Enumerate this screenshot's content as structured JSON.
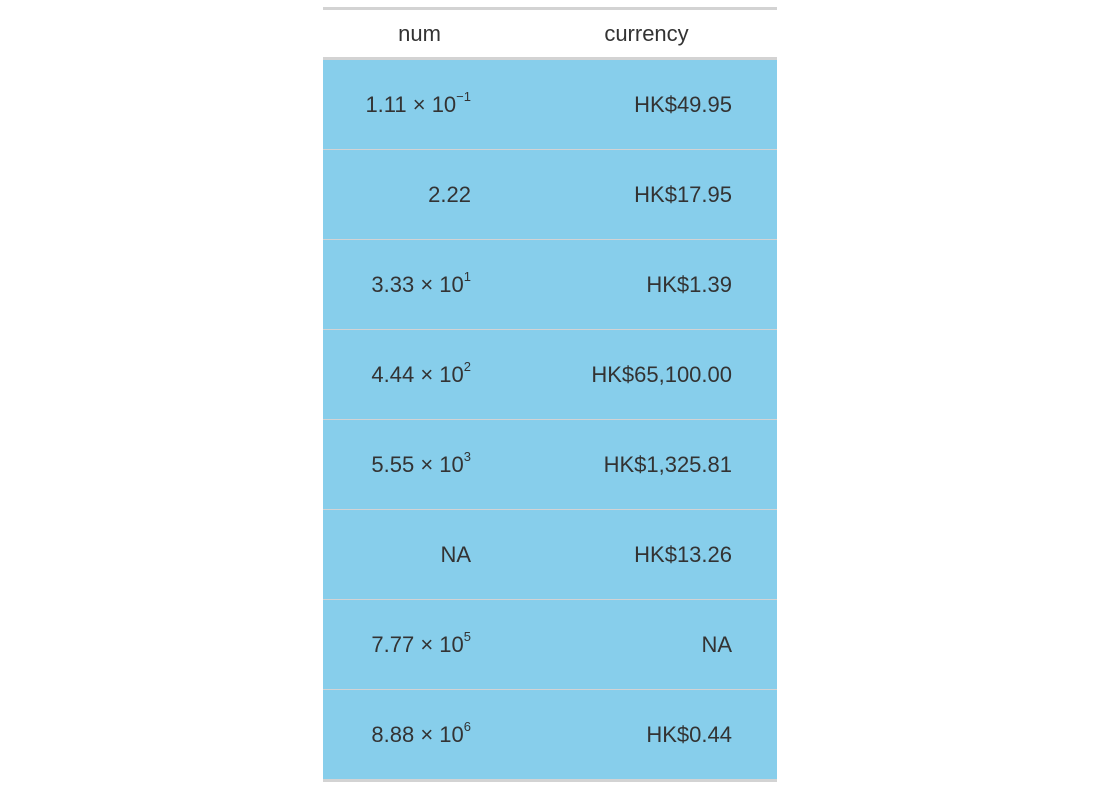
{
  "columns": [
    "num",
    "currency"
  ],
  "colors": {
    "body_fill": "#87CEEB",
    "border": "#D3D3D3",
    "text": "#333333",
    "header_fill": "#FFFFFF"
  },
  "rows": [
    {
      "num": {
        "mantissa": "1.11",
        "times": " × 10",
        "exponent": "−1"
      },
      "currency": "HK$49.95"
    },
    {
      "num": {
        "mantissa": "2.22",
        "times": "",
        "exponent": ""
      },
      "currency": "HK$17.95"
    },
    {
      "num": {
        "mantissa": "3.33",
        "times": " × 10",
        "exponent": "1"
      },
      "currency": "HK$1.39"
    },
    {
      "num": {
        "mantissa": "4.44",
        "times": " × 10",
        "exponent": "2"
      },
      "currency": "HK$65,100.00"
    },
    {
      "num": {
        "mantissa": "5.55",
        "times": " × 10",
        "exponent": "3"
      },
      "currency": "HK$1,325.81"
    },
    {
      "num": {
        "mantissa": "NA",
        "times": "",
        "exponent": ""
      },
      "currency": "HK$13.26"
    },
    {
      "num": {
        "mantissa": "7.77",
        "times": " × 10",
        "exponent": "5"
      },
      "currency": "NA"
    },
    {
      "num": {
        "mantissa": "8.88",
        "times": " × 10",
        "exponent": "6"
      },
      "currency": "HK$0.44"
    }
  ]
}
